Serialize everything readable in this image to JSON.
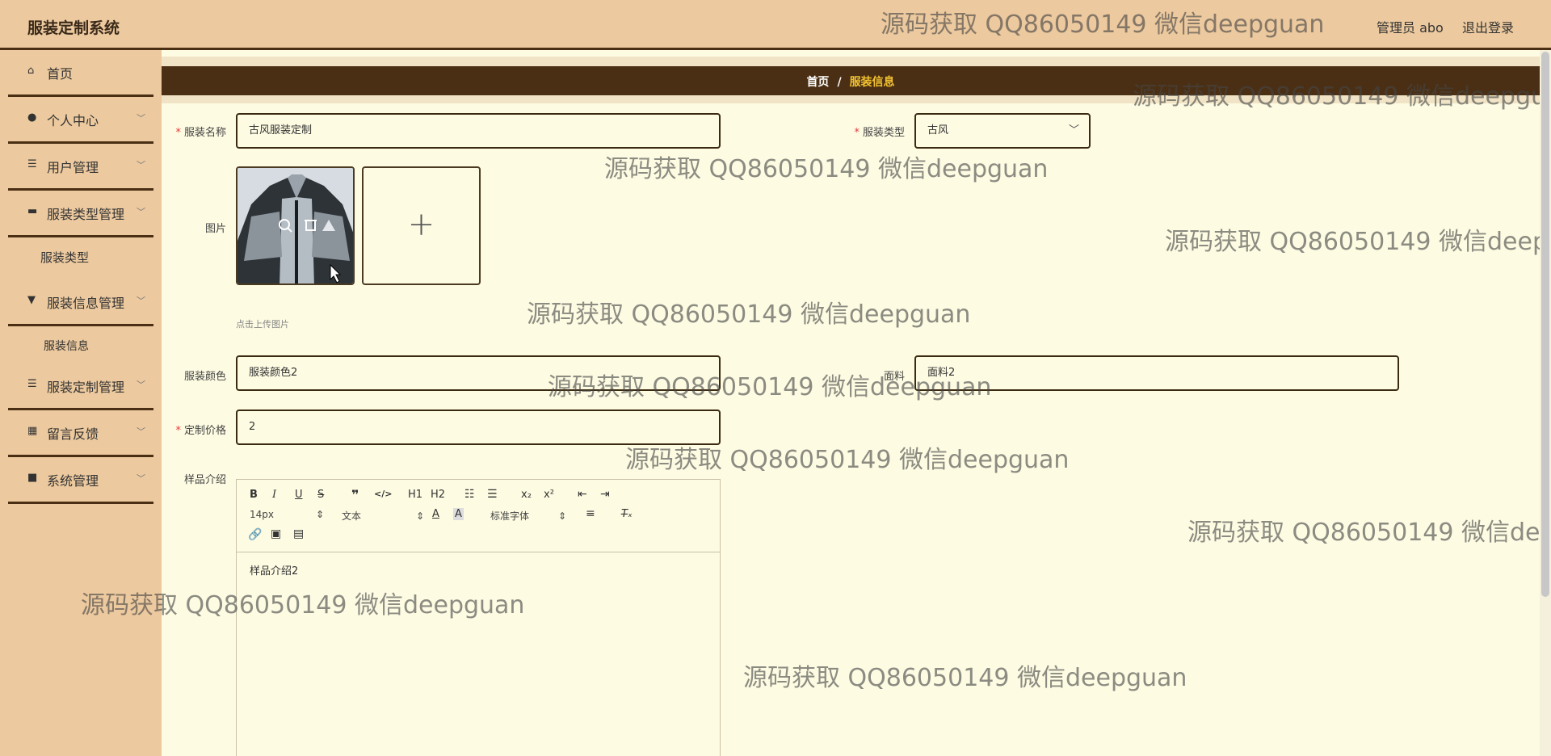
{
  "header": {
    "app_title": "服装定制系统",
    "user_info": "管理员 abo",
    "logout_label": "退出登录"
  },
  "sidebar": {
    "items": [
      {
        "label": "首页",
        "icon": "home-icon"
      },
      {
        "label": "个人中心",
        "icon": "user-icon"
      },
      {
        "label": "用户管理",
        "icon": "sliders-icon"
      },
      {
        "label": "服装类型管理",
        "icon": "briefcase-icon"
      },
      {
        "label": "服装信息管理",
        "icon": "tag-icon"
      },
      {
        "label": "服装定制管理",
        "icon": "list-icon"
      },
      {
        "label": "留言反馈",
        "icon": "grid-icon"
      },
      {
        "label": "系统管理",
        "icon": "apps-icon"
      }
    ],
    "sub_items": {
      "clothing_type": "服装类型",
      "clothing_info": "服装信息"
    }
  },
  "breadcrumb": {
    "home": "首页",
    "separator": "/",
    "current": "服装信息"
  },
  "form": {
    "name": {
      "label": "服装名称",
      "value": "古风服装定制",
      "required": true
    },
    "type": {
      "label": "服装类型",
      "value": "古风",
      "required": true
    },
    "image": {
      "label": "图片",
      "tip": "点击上传图片"
    },
    "color": {
      "label": "服装颜色",
      "value": "服装颜色2"
    },
    "fabric": {
      "label": "面料",
      "value": "面料2"
    },
    "price": {
      "label": "定制价格",
      "value": "2",
      "required": true
    },
    "intro": {
      "label": "样品介绍",
      "content": "样品介绍2",
      "toolbar": {
        "font_size": "14px",
        "block_format": "文本",
        "font_family": "标准字体",
        "h1": "H1",
        "h2": "H2"
      }
    }
  },
  "watermark_text": "源码获取 QQ86050149 微信deepguan",
  "colors": {
    "header_bg": "#ecc99e",
    "dark_brown": "#4a2f14",
    "content_bg": "#fdfbe2",
    "accent_gold": "#f2c230",
    "required_red": "#e4393c"
  }
}
